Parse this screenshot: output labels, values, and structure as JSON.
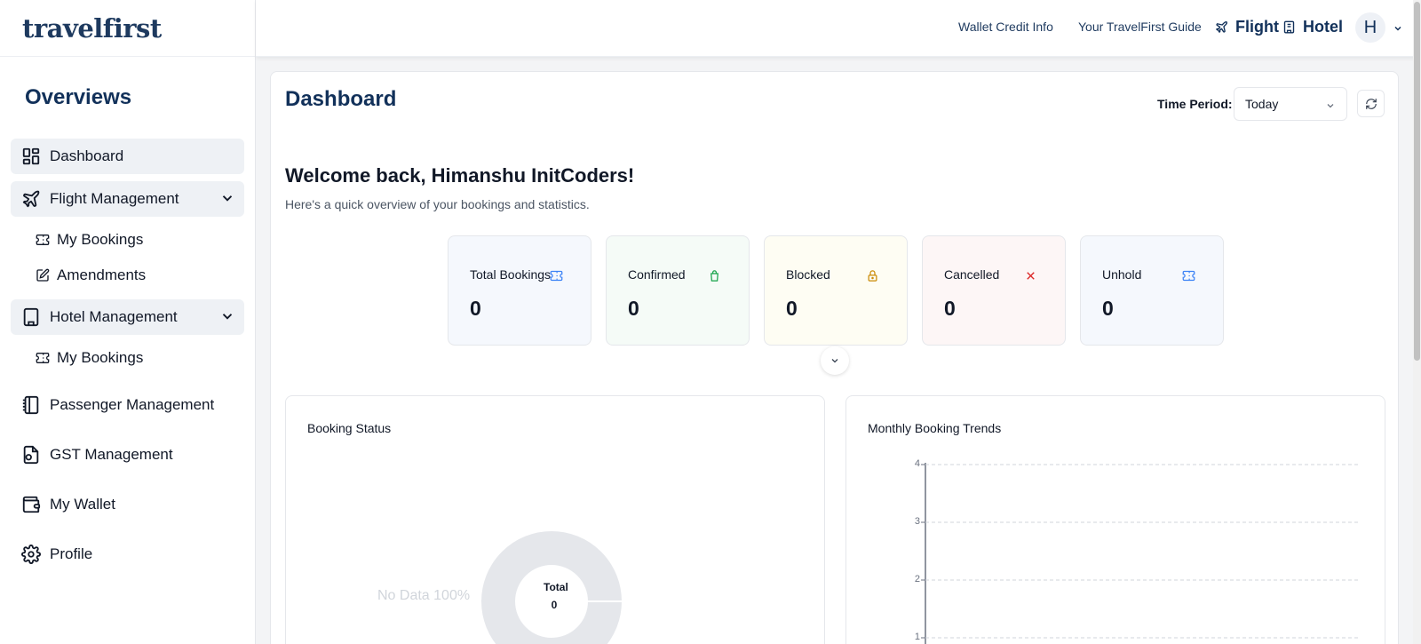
{
  "brand": {
    "logo": "travelfirst"
  },
  "sidebar": {
    "section_title": "Overviews",
    "items": [
      {
        "label": "Dashboard",
        "icon": "dashboard-icon"
      },
      {
        "label": "Flight Management",
        "icon": "plane-icon"
      },
      {
        "label": "My Bookings",
        "icon": "ticket-icon"
      },
      {
        "label": "Amendments",
        "icon": "edit-icon"
      },
      {
        "label": "Hotel Management",
        "icon": "building-icon"
      },
      {
        "label": "My Bookings",
        "icon": "ticket-icon"
      },
      {
        "label": "Passenger Management",
        "icon": "notebook-icon"
      },
      {
        "label": "GST Management",
        "icon": "receipt-icon"
      },
      {
        "label": "My Wallet",
        "icon": "wallet-icon"
      },
      {
        "label": "Profile",
        "icon": "gear-icon"
      }
    ]
  },
  "topbar": {
    "wallet_link": "Wallet Credit Info",
    "guide_link": "Your TravelFirst Guide",
    "flight": "Flight",
    "hotel": "Hotel",
    "avatar": "H"
  },
  "dashboard": {
    "title": "Dashboard",
    "time_period_label": "Time Period:",
    "time_period_value": "Today",
    "welcome": "Welcome back, Himanshu InitCoders!",
    "subtitle": "Here's a quick overview of your bookings and statistics.",
    "stats": [
      {
        "label": "Total Bookings",
        "value": "0",
        "color": "#3b82f6",
        "bg": "#f5f8fd"
      },
      {
        "label": "Confirmed",
        "value": "0",
        "color": "#16a34a",
        "bg": "#f5fbf7"
      },
      {
        "label": "Blocked",
        "value": "0",
        "color": "#ca8a04",
        "bg": "#fefdf3"
      },
      {
        "label": "Cancelled",
        "value": "0",
        "color": "#dc2626",
        "bg": "#fdf6f6"
      },
      {
        "label": "Unhold",
        "value": "0",
        "color": "#3b82f6",
        "bg": "#f5f8fd"
      }
    ]
  },
  "booking_status": {
    "title": "Booking Status",
    "no_data": "No Data 100%",
    "total_label": "Total",
    "total_value": "0"
  },
  "chart_data": {
    "type": "line",
    "title": "Monthly Booking Trends",
    "xlabel": "",
    "ylabel": "",
    "ylim": [
      0,
      4
    ],
    "yticks": [
      "4",
      "3",
      "2",
      "1"
    ],
    "grid": true,
    "series": []
  }
}
